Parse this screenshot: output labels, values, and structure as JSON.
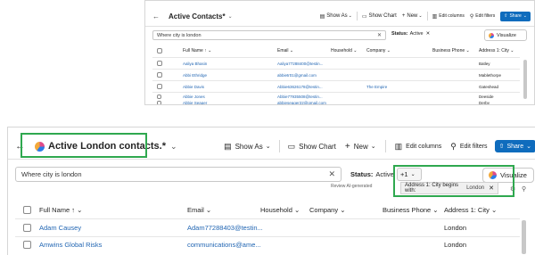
{
  "top": {
    "title": "Active Contacts*",
    "toolbar": {
      "show_as": "Show As",
      "show_chart": "Show Chart",
      "new": "New",
      "edit_columns": "Edit columns",
      "edit_filters": "Edit filters",
      "share": "Share"
    },
    "search_value": "Where city is london",
    "status_label": "Status:",
    "status_value": "Active",
    "visualize": "Visualize",
    "columns": [
      "Full Name",
      "Email",
      "Household",
      "Company",
      "Business Phone",
      "Address 1: City"
    ],
    "rows": [
      {
        "name": "Aaliya Bhasin",
        "email": "Aaliya77288400@testin...",
        "company": "",
        "city": "Batley"
      },
      {
        "name": "Abbi Ethridge",
        "email": "abbietr01@gmail.com",
        "company": "",
        "city": "Mablethorpe"
      },
      {
        "name": "Abbie Davis",
        "email": "Abbie63626178@testin...",
        "company": "The Empire",
        "city": "Gateshead"
      },
      {
        "name": "Abbie Jones",
        "email": "Abbie77935508@testin...",
        "company": "",
        "city": "Deeside"
      },
      {
        "name": "Abbie Seager",
        "email": "abbieseager22@gmail.com",
        "company": "",
        "city": "Derby"
      }
    ]
  },
  "bottom": {
    "title": "Active London contacts.*",
    "toolbar": {
      "show_as": "Show As",
      "show_chart": "Show Chart",
      "new": "New",
      "edit_columns": "Edit columns",
      "edit_filters": "Edit filters",
      "share": "Share"
    },
    "search_value": "Where city is london",
    "status_label": "Status:",
    "status_value": "Active",
    "plus_count": "+1",
    "visualize": "Visualize",
    "review_text": "Review AI-generated",
    "filter_label": "Address 1: City begins with:",
    "filter_value": "London",
    "columns": [
      "Full Name",
      "Email",
      "Household",
      "Company",
      "Business Phone",
      "Address 1: City"
    ],
    "rows": [
      {
        "name": "Adam Causey",
        "email": "Adam77288403@testin...",
        "city": "London"
      },
      {
        "name": "Amwins Global Risks",
        "email": "communications@ame...",
        "city": "London"
      }
    ]
  },
  "colors": {
    "accent": "#0f6cbd",
    "highlight": "#2fa84f",
    "link": "#2266b3"
  }
}
